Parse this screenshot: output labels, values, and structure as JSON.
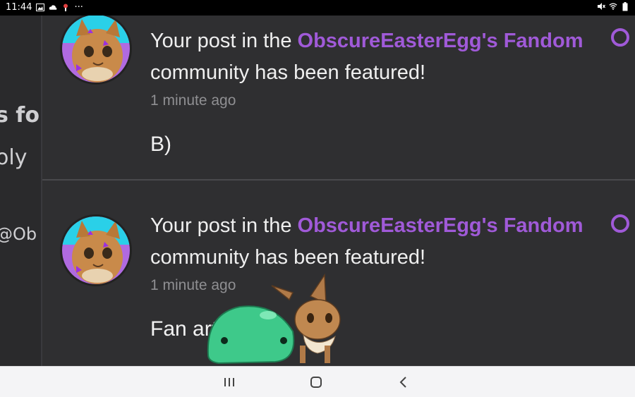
{
  "status_bar": {
    "time": "11:44",
    "overflow": "···",
    "left_icons": [
      "gallery-icon",
      "cloud-icon",
      "notification-icon"
    ],
    "right_icons": [
      "mute-icon",
      "wifi-icon",
      "battery-icon"
    ]
  },
  "left_panel": {
    "peek_lines": [
      "s fo",
      "oly",
      "@Ob"
    ]
  },
  "notifications": [
    {
      "prefix": "Your post in the ",
      "community": "ObscureEasterEgg's Fandom",
      "suffix": " community has been featured!",
      "time": "1 minute ago",
      "body": "B)",
      "unread": true
    },
    {
      "prefix": "Your post in the ",
      "community": "ObscureEasterEgg's Fandom",
      "suffix": " community has been featured!",
      "time": "1 minute ago",
      "body": "Fan art time",
      "unread": true
    }
  ],
  "nav_bar": {
    "buttons": [
      "recent-apps",
      "home",
      "back"
    ]
  },
  "colors": {
    "accent": "#a05ad8",
    "feed_bg": "#2f2f31",
    "text": "#efefef",
    "muted": "#8f8f92"
  }
}
